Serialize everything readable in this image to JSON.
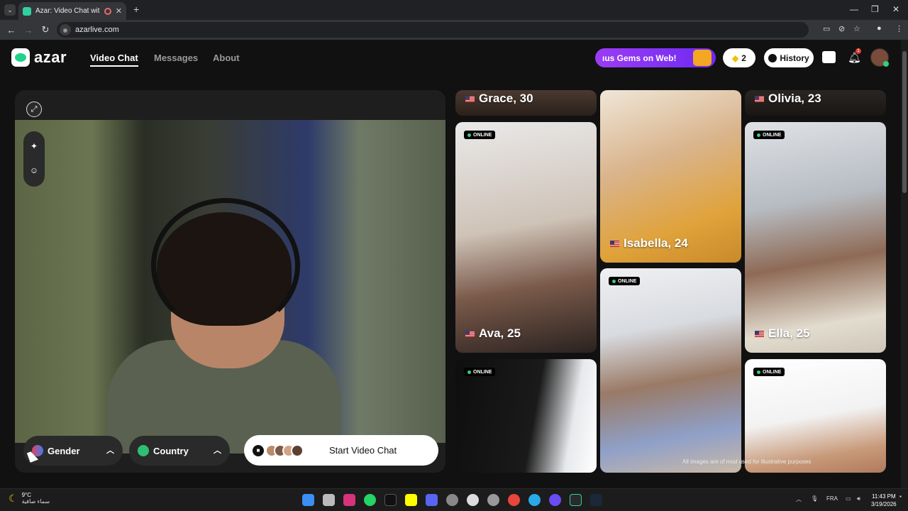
{
  "browser": {
    "tab_title": "Azar: Video Chat with New",
    "tab_close": "✕",
    "newtab": "+",
    "url": "azarlive.com",
    "window_controls": [
      "—",
      "❐",
      "✕"
    ]
  },
  "header": {
    "logo": "azar",
    "nav": [
      {
        "label": "Video Chat",
        "active": true
      },
      {
        "label": "Messages",
        "active": false
      },
      {
        "label": "About",
        "active": false
      }
    ],
    "promo": "ıus Gems on Web!",
    "gems_count": "2",
    "history_label": "History",
    "notification_count": "1"
  },
  "panel": {
    "gender_label": "Gender",
    "country_label": "Country",
    "start_label": "Start Video Chat"
  },
  "profiles": [
    {
      "name": "Grace, 30",
      "online": false
    },
    {
      "name": "Isabella, 24",
      "online": false
    },
    {
      "name": "Olivia, 23",
      "online": false
    },
    {
      "name": "Ava, 25",
      "online": true
    },
    {
      "name": "Ella, 25",
      "online": true
    },
    {
      "name": "",
      "online": true
    },
    {
      "name": "",
      "online": true
    },
    {
      "name": "",
      "online": true
    }
  ],
  "online_badge": "ONLINE",
  "disclaimer": "All images are of mod      used for illustrative purposes",
  "taskbar": {
    "temp": "9°C",
    "weather_desc": "سماء صافية",
    "lang": "FRA",
    "time": "11:43 PM",
    "date": "3/19/2026"
  },
  "colors": {
    "accent": "#1fd28a",
    "promo": "#8a35f3",
    "online_dot": "#2fd27a"
  }
}
